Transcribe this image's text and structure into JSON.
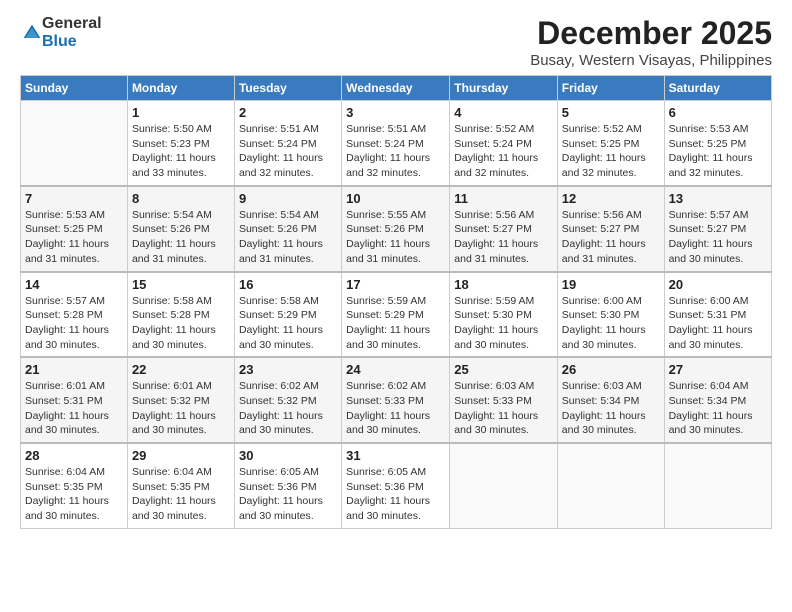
{
  "logo": {
    "general": "General",
    "blue": "Blue"
  },
  "title": "December 2025",
  "subtitle": "Busay, Western Visayas, Philippines",
  "headers": [
    "Sunday",
    "Monday",
    "Tuesday",
    "Wednesday",
    "Thursday",
    "Friday",
    "Saturday"
  ],
  "weeks": [
    [
      {
        "day": "",
        "sunrise": "",
        "sunset": "",
        "daylight": ""
      },
      {
        "day": "1",
        "sunrise": "Sunrise: 5:50 AM",
        "sunset": "Sunset: 5:23 PM",
        "daylight": "Daylight: 11 hours and 33 minutes."
      },
      {
        "day": "2",
        "sunrise": "Sunrise: 5:51 AM",
        "sunset": "Sunset: 5:24 PM",
        "daylight": "Daylight: 11 hours and 32 minutes."
      },
      {
        "day": "3",
        "sunrise": "Sunrise: 5:51 AM",
        "sunset": "Sunset: 5:24 PM",
        "daylight": "Daylight: 11 hours and 32 minutes."
      },
      {
        "day": "4",
        "sunrise": "Sunrise: 5:52 AM",
        "sunset": "Sunset: 5:24 PM",
        "daylight": "Daylight: 11 hours and 32 minutes."
      },
      {
        "day": "5",
        "sunrise": "Sunrise: 5:52 AM",
        "sunset": "Sunset: 5:25 PM",
        "daylight": "Daylight: 11 hours and 32 minutes."
      },
      {
        "day": "6",
        "sunrise": "Sunrise: 5:53 AM",
        "sunset": "Sunset: 5:25 PM",
        "daylight": "Daylight: 11 hours and 32 minutes."
      }
    ],
    [
      {
        "day": "7",
        "sunrise": "Sunrise: 5:53 AM",
        "sunset": "Sunset: 5:25 PM",
        "daylight": "Daylight: 11 hours and 31 minutes."
      },
      {
        "day": "8",
        "sunrise": "Sunrise: 5:54 AM",
        "sunset": "Sunset: 5:26 PM",
        "daylight": "Daylight: 11 hours and 31 minutes."
      },
      {
        "day": "9",
        "sunrise": "Sunrise: 5:54 AM",
        "sunset": "Sunset: 5:26 PM",
        "daylight": "Daylight: 11 hours and 31 minutes."
      },
      {
        "day": "10",
        "sunrise": "Sunrise: 5:55 AM",
        "sunset": "Sunset: 5:26 PM",
        "daylight": "Daylight: 11 hours and 31 minutes."
      },
      {
        "day": "11",
        "sunrise": "Sunrise: 5:56 AM",
        "sunset": "Sunset: 5:27 PM",
        "daylight": "Daylight: 11 hours and 31 minutes."
      },
      {
        "day": "12",
        "sunrise": "Sunrise: 5:56 AM",
        "sunset": "Sunset: 5:27 PM",
        "daylight": "Daylight: 11 hours and 31 minutes."
      },
      {
        "day": "13",
        "sunrise": "Sunrise: 5:57 AM",
        "sunset": "Sunset: 5:27 PM",
        "daylight": "Daylight: 11 hours and 30 minutes."
      }
    ],
    [
      {
        "day": "14",
        "sunrise": "Sunrise: 5:57 AM",
        "sunset": "Sunset: 5:28 PM",
        "daylight": "Daylight: 11 hours and 30 minutes."
      },
      {
        "day": "15",
        "sunrise": "Sunrise: 5:58 AM",
        "sunset": "Sunset: 5:28 PM",
        "daylight": "Daylight: 11 hours and 30 minutes."
      },
      {
        "day": "16",
        "sunrise": "Sunrise: 5:58 AM",
        "sunset": "Sunset: 5:29 PM",
        "daylight": "Daylight: 11 hours and 30 minutes."
      },
      {
        "day": "17",
        "sunrise": "Sunrise: 5:59 AM",
        "sunset": "Sunset: 5:29 PM",
        "daylight": "Daylight: 11 hours and 30 minutes."
      },
      {
        "day": "18",
        "sunrise": "Sunrise: 5:59 AM",
        "sunset": "Sunset: 5:30 PM",
        "daylight": "Daylight: 11 hours and 30 minutes."
      },
      {
        "day": "19",
        "sunrise": "Sunrise: 6:00 AM",
        "sunset": "Sunset: 5:30 PM",
        "daylight": "Daylight: 11 hours and 30 minutes."
      },
      {
        "day": "20",
        "sunrise": "Sunrise: 6:00 AM",
        "sunset": "Sunset: 5:31 PM",
        "daylight": "Daylight: 11 hours and 30 minutes."
      }
    ],
    [
      {
        "day": "21",
        "sunrise": "Sunrise: 6:01 AM",
        "sunset": "Sunset: 5:31 PM",
        "daylight": "Daylight: 11 hours and 30 minutes."
      },
      {
        "day": "22",
        "sunrise": "Sunrise: 6:01 AM",
        "sunset": "Sunset: 5:32 PM",
        "daylight": "Daylight: 11 hours and 30 minutes."
      },
      {
        "day": "23",
        "sunrise": "Sunrise: 6:02 AM",
        "sunset": "Sunset: 5:32 PM",
        "daylight": "Daylight: 11 hours and 30 minutes."
      },
      {
        "day": "24",
        "sunrise": "Sunrise: 6:02 AM",
        "sunset": "Sunset: 5:33 PM",
        "daylight": "Daylight: 11 hours and 30 minutes."
      },
      {
        "day": "25",
        "sunrise": "Sunrise: 6:03 AM",
        "sunset": "Sunset: 5:33 PM",
        "daylight": "Daylight: 11 hours and 30 minutes."
      },
      {
        "day": "26",
        "sunrise": "Sunrise: 6:03 AM",
        "sunset": "Sunset: 5:34 PM",
        "daylight": "Daylight: 11 hours and 30 minutes."
      },
      {
        "day": "27",
        "sunrise": "Sunrise: 6:04 AM",
        "sunset": "Sunset: 5:34 PM",
        "daylight": "Daylight: 11 hours and 30 minutes."
      }
    ],
    [
      {
        "day": "28",
        "sunrise": "Sunrise: 6:04 AM",
        "sunset": "Sunset: 5:35 PM",
        "daylight": "Daylight: 11 hours and 30 minutes."
      },
      {
        "day": "29",
        "sunrise": "Sunrise: 6:04 AM",
        "sunset": "Sunset: 5:35 PM",
        "daylight": "Daylight: 11 hours and 30 minutes."
      },
      {
        "day": "30",
        "sunrise": "Sunrise: 6:05 AM",
        "sunset": "Sunset: 5:36 PM",
        "daylight": "Daylight: 11 hours and 30 minutes."
      },
      {
        "day": "31",
        "sunrise": "Sunrise: 6:05 AM",
        "sunset": "Sunset: 5:36 PM",
        "daylight": "Daylight: 11 hours and 30 minutes."
      },
      {
        "day": "",
        "sunrise": "",
        "sunset": "",
        "daylight": ""
      },
      {
        "day": "",
        "sunrise": "",
        "sunset": "",
        "daylight": ""
      },
      {
        "day": "",
        "sunrise": "",
        "sunset": "",
        "daylight": ""
      }
    ]
  ]
}
